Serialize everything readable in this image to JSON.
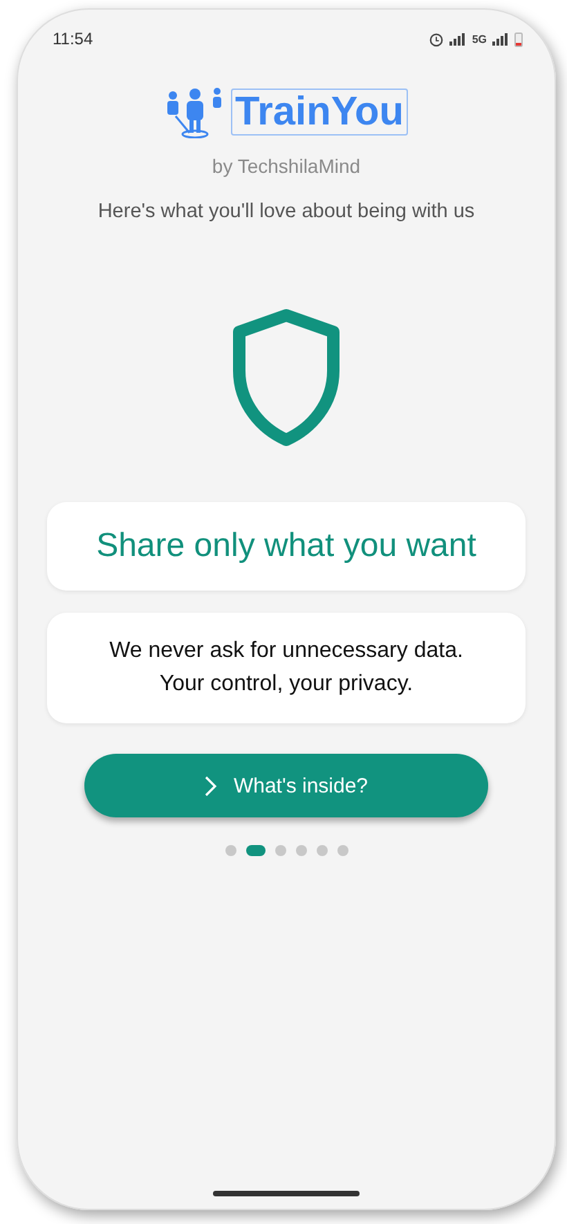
{
  "status_bar": {
    "time": "11:54",
    "network": "5G"
  },
  "brand": {
    "name": "TrainYou",
    "byline": "by TechshilaMind"
  },
  "intro": "Here's what you'll love about being with us",
  "slide": {
    "title": "Share only what you want",
    "body": "We never ask for unnecessary data.\nYour control, your privacy."
  },
  "button": {
    "label": "What's inside?"
  },
  "pager": [
    {
      "selected": false
    },
    {
      "selected": true
    },
    {
      "selected": false
    },
    {
      "selected": false
    },
    {
      "selected": false
    },
    {
      "selected": false
    }
  ]
}
